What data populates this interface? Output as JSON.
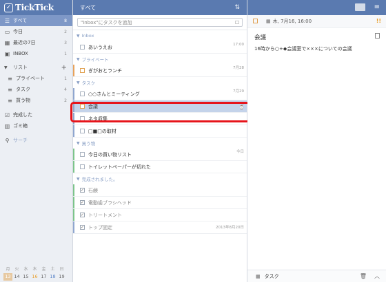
{
  "app": {
    "name": "TickTick"
  },
  "sidebar": {
    "smart_lists": [
      {
        "label": "すべて",
        "count": "8",
        "icon": "inbox-stack-icon",
        "active": true
      },
      {
        "label": "今日",
        "count": "2",
        "icon": "calendar-today-icon"
      },
      {
        "label": "最近の7日",
        "count": "3",
        "icon": "calendar-week-icon"
      },
      {
        "label": "INBOX",
        "count": "1",
        "icon": "inbox-icon"
      }
    ],
    "lists_header": "リスト",
    "lists": [
      {
        "label": "プライベート",
        "count": "1"
      },
      {
        "label": "タスク",
        "count": "4"
      },
      {
        "label": "買う物",
        "count": "2"
      }
    ],
    "completed": "完成した",
    "trash": "ゴミ箱",
    "search": "サーチ",
    "calendar": {
      "weekdays": [
        "月",
        "火",
        "水",
        "木",
        "金",
        "土",
        "日"
      ],
      "dates": [
        "13",
        "14",
        "15",
        "16",
        "17",
        "18",
        "19"
      ],
      "today": "13"
    }
  },
  "middle": {
    "header_title": "すべて",
    "add_placeholder": "\"Inbox\"にタスクを追加",
    "sections": {
      "inbox": "Inbox",
      "private": "プライベート",
      "tasks": "タスク",
      "shopping": "買う物",
      "completed": "完成されました。"
    },
    "inbox_tasks": [
      {
        "title": "あいうえお",
        "meta": "17:00"
      }
    ],
    "private_tasks": [
      {
        "title": "ぎがおとランチ",
        "meta": "7月28"
      }
    ],
    "task_tasks": [
      {
        "title": "○○さんとミーティング",
        "meta": "7月29"
      },
      {
        "title": "会議",
        "meta": ""
      },
      {
        "title": "ネタ収集",
        "meta": ""
      },
      {
        "title": "□■□の取材",
        "meta": ""
      }
    ],
    "shopping_tasks": [
      {
        "title": "今日の買い物リスト",
        "meta": "今日"
      },
      {
        "title": "トイレットペーパーが切れた",
        "meta": ""
      }
    ],
    "completed_tasks": [
      {
        "title": "石鹸",
        "meta": ""
      },
      {
        "title": "電動歯ブラシヘッド",
        "meta": ""
      },
      {
        "title": "トリートメント",
        "meta": ""
      },
      {
        "title": "トップ固定",
        "meta": "2013年8月20日"
      }
    ]
  },
  "detail": {
    "date": "木, 7月16, 16:00",
    "priority": "!!",
    "title": "会議",
    "content": "16時から○+◆会議室で×××についての会議",
    "list_name": "タスク"
  },
  "colors": {
    "header": "#5a7ab0",
    "active_nav": "#7e98c7",
    "selected_row": "#c4d3ea",
    "highlight": "#e6141b",
    "priority_orange": "#e8a030",
    "private_bar": "#e8a25a",
    "task_bar": "#8fa6cf",
    "shopping_bar": "#7cc48a"
  }
}
